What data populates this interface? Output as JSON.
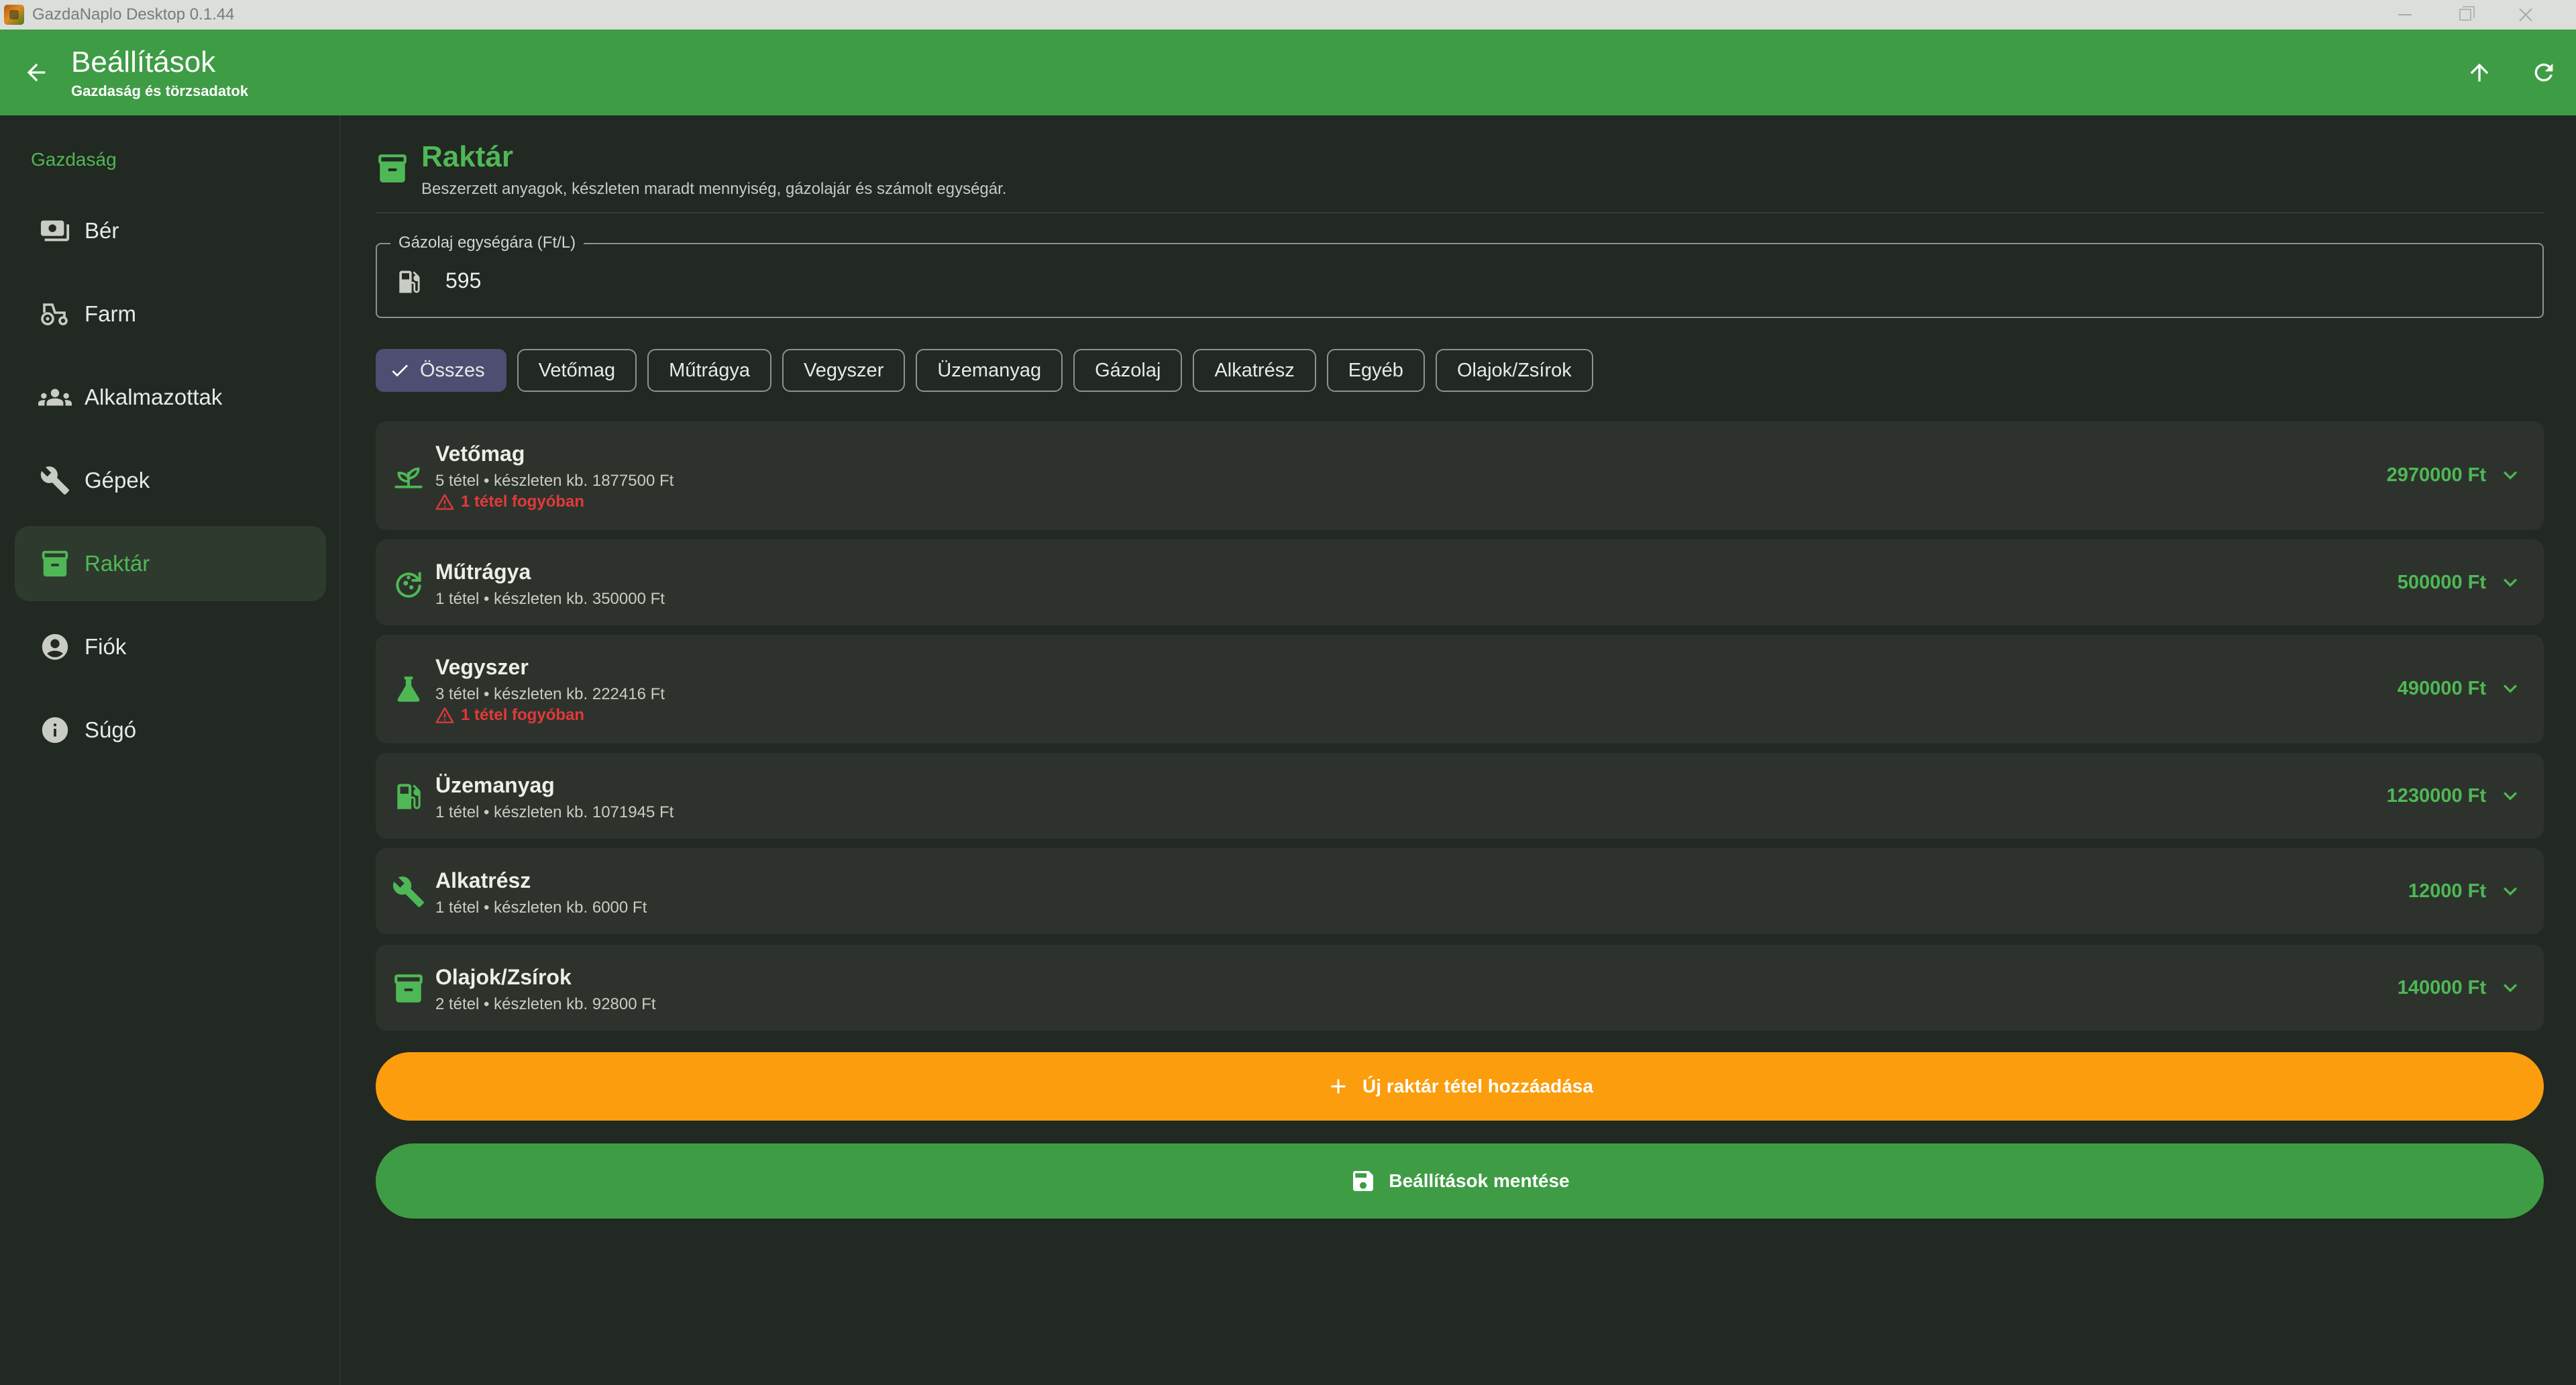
{
  "window": {
    "title": "GazdaNaplo Desktop 0.1.44"
  },
  "header": {
    "title": "Beállítások",
    "subtitle": "Gazdaság és törzsadatok"
  },
  "sidebar": {
    "section": "Gazdaság",
    "items": [
      {
        "label": "Bér",
        "icon": "payments-icon"
      },
      {
        "label": "Farm",
        "icon": "tractor-icon"
      },
      {
        "label": "Alkalmazottak",
        "icon": "people-icon"
      },
      {
        "label": "Gépek",
        "icon": "wrench-icon"
      },
      {
        "label": "Raktár",
        "icon": "inventory-box-icon",
        "active": true
      },
      {
        "label": "Fiók",
        "icon": "account-circle-icon"
      },
      {
        "label": "Súgó",
        "icon": "info-icon"
      }
    ]
  },
  "main": {
    "section_title": "Raktár",
    "section_desc": "Beszerzett anyagok, készleten maradt mennyiség, gázolajár és számolt egységár.",
    "fuel_field": {
      "label": "Gázolaj egységára (Ft/L)",
      "value": "595"
    },
    "filters": [
      {
        "label": "Összes",
        "selected": true
      },
      {
        "label": "Vetőmag"
      },
      {
        "label": "Műtrágya"
      },
      {
        "label": "Vegyszer"
      },
      {
        "label": "Üzemanyag"
      },
      {
        "label": "Gázolaj"
      },
      {
        "label": "Alkatrész"
      },
      {
        "label": "Egyéb"
      },
      {
        "label": "Olajok/Zsírok"
      }
    ],
    "categories": [
      {
        "name": "Vetőmag",
        "meta": "5 tétel • készleten kb. 1877500 Ft",
        "warning": "1 tétel fogyóban",
        "total": "2970000 Ft",
        "icon": "sprout-icon"
      },
      {
        "name": "Műtrágya",
        "meta": "1 tétel • készleten kb. 350000 Ft",
        "total": "500000 Ft",
        "icon": "compost-icon"
      },
      {
        "name": "Vegyszer",
        "meta": "3 tétel • készleten kb. 222416 Ft",
        "warning": "1 tétel fogyóban",
        "total": "490000 Ft",
        "icon": "flask-icon"
      },
      {
        "name": "Üzemanyag",
        "meta": "1 tétel • készleten kb. 1071945 Ft",
        "total": "1230000 Ft",
        "icon": "fuel-pump-icon"
      },
      {
        "name": "Alkatrész",
        "meta": "1 tétel • készleten kb. 6000 Ft",
        "total": "12000 Ft",
        "icon": "wrench-icon"
      },
      {
        "name": "Olajok/Zsírok",
        "meta": "2 tétel • készleten kb. 92800 Ft",
        "total": "140000 Ft",
        "icon": "inventory-box-icon"
      }
    ],
    "add_button": "Új raktár tétel hozzáadása",
    "save_button": "Beállítások mentése"
  },
  "colors": {
    "primary": "#3e9c45",
    "accent": "#fb9d0c",
    "warning": "#e2393a",
    "selected_chip": "#4e4e72",
    "background": "#222822",
    "card": "#2d332c"
  }
}
